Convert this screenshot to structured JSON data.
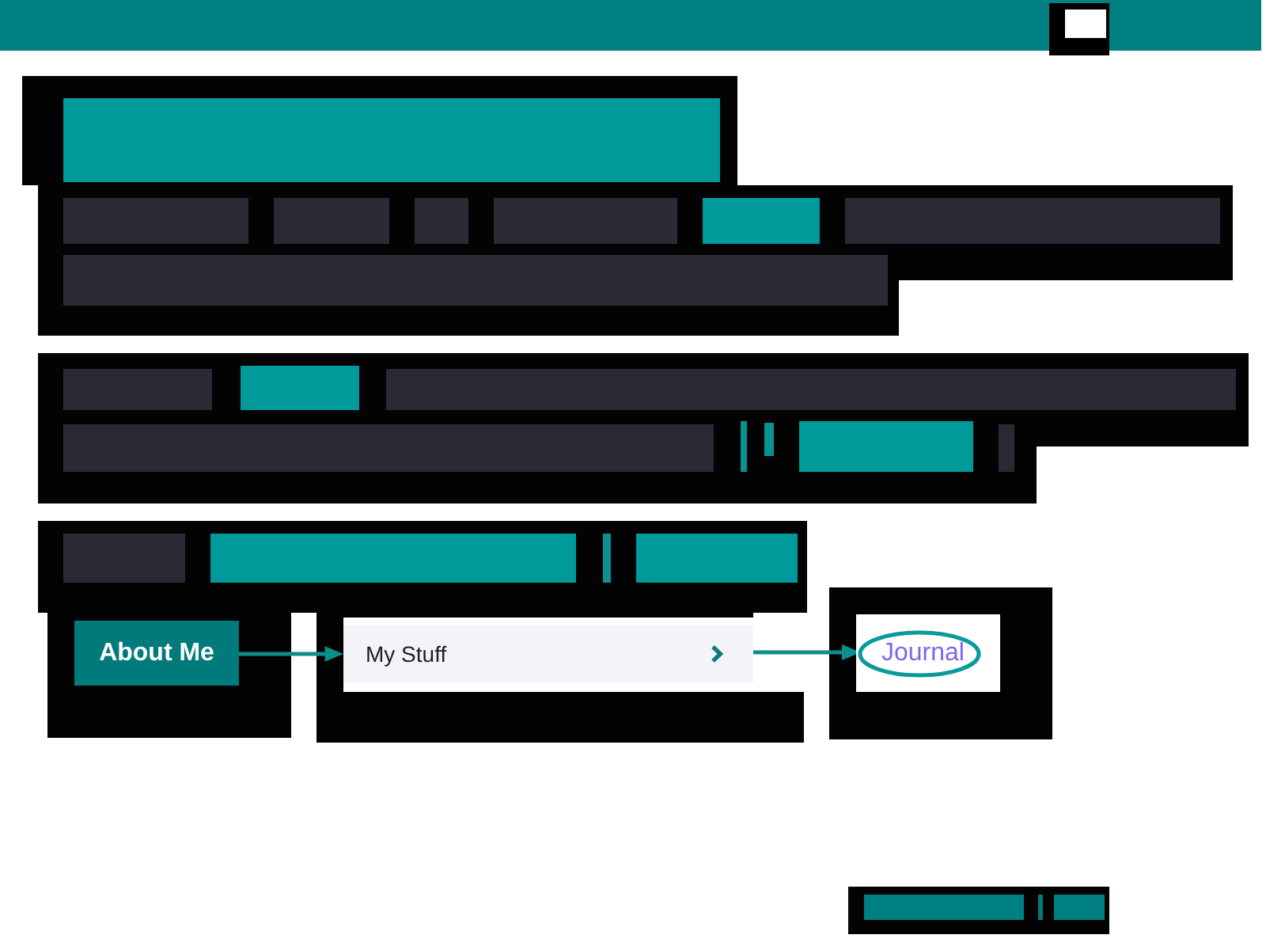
{
  "redacted_sections": [
    {
      "lines": [
        {
          "blocks": [
            {
              "kind": "heading"
            }
          ]
        },
        {
          "blocks": [
            {
              "kind": "text"
            },
            {
              "kind": "text"
            },
            {
              "kind": "text"
            },
            {
              "kind": "text"
            },
            {
              "kind": "link"
            },
            {
              "kind": "text"
            }
          ]
        },
        {
          "blocks": [
            {
              "kind": "text"
            }
          ]
        }
      ]
    },
    {
      "lines": [
        {
          "blocks": [
            {
              "kind": "text"
            },
            {
              "kind": "link"
            },
            {
              "kind": "text"
            }
          ]
        },
        {
          "blocks": [
            {
              "kind": "text"
            },
            {
              "kind": "divider"
            },
            {
              "kind": "divider"
            },
            {
              "kind": "link"
            },
            {
              "kind": "text"
            }
          ]
        }
      ]
    },
    {
      "lines": [
        {
          "blocks": [
            {
              "kind": "text"
            },
            {
              "kind": "link"
            },
            {
              "kind": "divider"
            },
            {
              "kind": "link"
            }
          ]
        }
      ]
    }
  ],
  "diagram": {
    "nodes": [
      {
        "kind": "button",
        "label": "About Me"
      },
      {
        "kind": "menu_item",
        "label": "My Stuff"
      },
      {
        "kind": "link",
        "label": "Journal",
        "circled": true
      }
    ]
  },
  "footer": {
    "blocks": [
      {
        "kind": "link"
      },
      {
        "kind": "divider"
      },
      {
        "kind": "link"
      }
    ]
  }
}
